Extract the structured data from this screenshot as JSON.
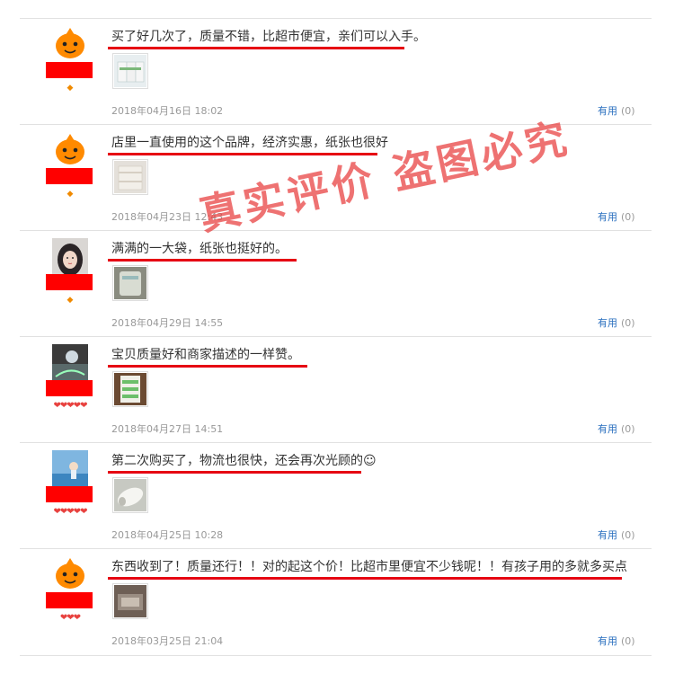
{
  "reviews": [
    {
      "comment": "买了好几次了，质量不错，比超市便宜，亲们可以入手。",
      "date": "2018年04月16日 18:02",
      "useful_label": "有用",
      "useful_count": "(0)",
      "badge": "◆",
      "avatar": "orange-mascot-avatar",
      "thumb": "tissue-pack"
    },
    {
      "comment": "店里一直使用的这个品牌，经济实惠，纸张也很好",
      "date": "2018年04月23日 12:43",
      "useful_label": "有用",
      "useful_count": "(0)",
      "badge": "◆",
      "avatar": "orange-mascot-avatar",
      "thumb": "tissue-box"
    },
    {
      "comment": "满满的一大袋，纸张也挺好的。",
      "date": "2018年04月29日 14:55",
      "useful_label": "有用",
      "useful_count": "(0)",
      "badge": "◆",
      "avatar": "girl-photo-avatar",
      "thumb": "tissue-bag"
    },
    {
      "comment": "宝贝质量好和商家描述的一样赞。",
      "date": "2018年04月27日 14:51",
      "useful_label": "有用",
      "useful_count": "(0)",
      "badge": "❤❤❤❤❤",
      "avatar": "photo-avatar",
      "thumb": "tissue-pack-green"
    },
    {
      "comment": "第二次购买了，物流也很快，还会再次光顾的☺",
      "date": "2018年04月25日 10:28",
      "useful_label": "有用",
      "useful_count": "(0)",
      "badge": "❤❤❤❤❤",
      "avatar": "sea-photo-avatar",
      "thumb": "tissue-roll"
    },
    {
      "comment": "东西收到了！质量还行！！对的起这个价！比超市里便宜不少钱呢！！有孩子用的多就多买点",
      "date": "2018年03月25日 21:04",
      "useful_label": "有用",
      "useful_count": "(0)",
      "badge": "❤❤❤",
      "avatar": "orange-mascot-avatar",
      "thumb": "tissue-photo-dark"
    }
  ],
  "watermark": "真实评价  盗图必究"
}
